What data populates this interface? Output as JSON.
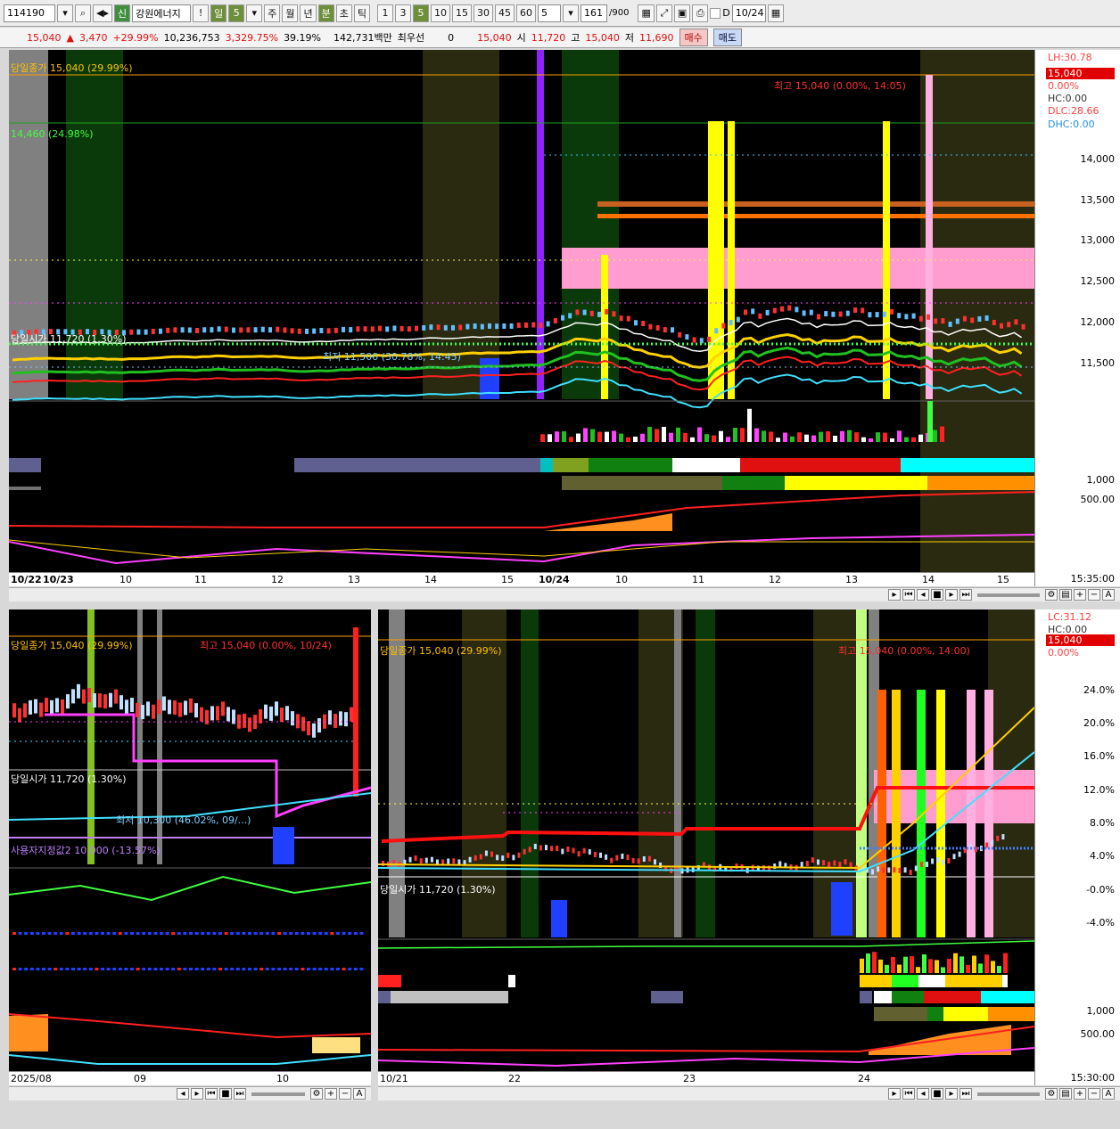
{
  "toolbar": {
    "code": "114190",
    "badge": "신",
    "name": "강원에너지",
    "alert": "!",
    "period_day": "일",
    "period_day_value": "5",
    "periods": [
      "주",
      "월",
      "년"
    ],
    "period_min": "분",
    "period_sec": "초",
    "period_tick": "틱",
    "intervals": [
      "1",
      "3",
      "5",
      "10",
      "15",
      "30",
      "45",
      "60"
    ],
    "interval_selected": "5",
    "interval_value": "5",
    "bar_count": "161",
    "bar_max": "/900",
    "date_prefix": "D",
    "date": "10/24"
  },
  "quote": {
    "price": "15,040",
    "change": "3,470",
    "change_pct": "+29.99%",
    "volume": "10,236,753",
    "volume_pct": "3,329.75%",
    "turnover_pct": "39.19%",
    "amount": "142,731백만",
    "pref_label": "최우선",
    "pref_value": "0",
    "last": "15,040",
    "open_label": "시",
    "open": "11,720",
    "high_label": "고",
    "high": "15,040",
    "low_label": "저",
    "low": "11,690",
    "buy": "매수",
    "sell": "매도"
  },
  "top_chart": {
    "close_label": "당일종가 15,040 (29.99%)",
    "prev_label": "14,460 (24.98%)",
    "high_label": "최고 15,040 (0.00%, 14:05)",
    "low_label": "최저 11,500 (30.78%, 14:45)",
    "open_label": "당일시가 11,720 (1.30%)",
    "axis_labels": [
      "14,000",
      "13,500",
      "13,000",
      "12,500",
      "12,000",
      "11,500"
    ],
    "tags": [
      {
        "text": "LH:30.78",
        "color": "#ff4040"
      },
      {
        "text": "15,040",
        "color": "#ffffff",
        "bg": "#e00000"
      },
      {
        "text": "0.00%",
        "color": "#ff4040"
      },
      {
        "text": "HC:0.00",
        "color": "#ffffff"
      },
      {
        "text": "DLC:28.66",
        "color": "#ff4040"
      },
      {
        "text": "DHC:0.00",
        "color": "#40c0ff"
      }
    ],
    "sub_axis": [
      "1,000",
      "500.00"
    ],
    "time_labels": [
      "10/22",
      "10/23",
      "10",
      "11",
      "12",
      "13",
      "14",
      "15",
      "10/24",
      "10",
      "11",
      "12",
      "13",
      "14",
      "15"
    ],
    "clock": "15:35:00"
  },
  "bottom_left": {
    "close_label": "당일종가 15,040 (29.99%)",
    "high_label": "최고 15,040 (0.00%, 10/24)",
    "open_label": "당일시가 11,720 (1.30%)",
    "low_label": "최저 10,300 (46.02%, 09/...)",
    "user_label": "사용자지정값2 10,000 (-13.57%)",
    "time_labels": [
      "2025/08",
      "09",
      "10"
    ]
  },
  "bottom_right": {
    "close_label": "당일종가 15,040 (29.99%)",
    "high_label": "최고 15,040 (0.00%, 14:00)",
    "open_label": "당일시가 11,720 (1.30%)",
    "tags": [
      {
        "text": "LC:31.12",
        "color": "#ff4040"
      },
      {
        "text": "HC:0.00",
        "color": "#ffffff"
      },
      {
        "text": "15,040",
        "color": "#ffffff",
        "bg": "#e00000"
      },
      {
        "text": "0.00%",
        "color": "#ff4040"
      }
    ],
    "axis_labels": [
      "24.0%",
      "20.0%",
      "16.0%",
      "12.0%",
      "8.0%",
      "4.0%",
      "-0.0%",
      "-4.0%"
    ],
    "sub_axis": [
      "1,000",
      "500.00"
    ],
    "time_labels": [
      "10/21",
      "22",
      "23",
      "24"
    ],
    "clock": "15:30:00"
  }
}
